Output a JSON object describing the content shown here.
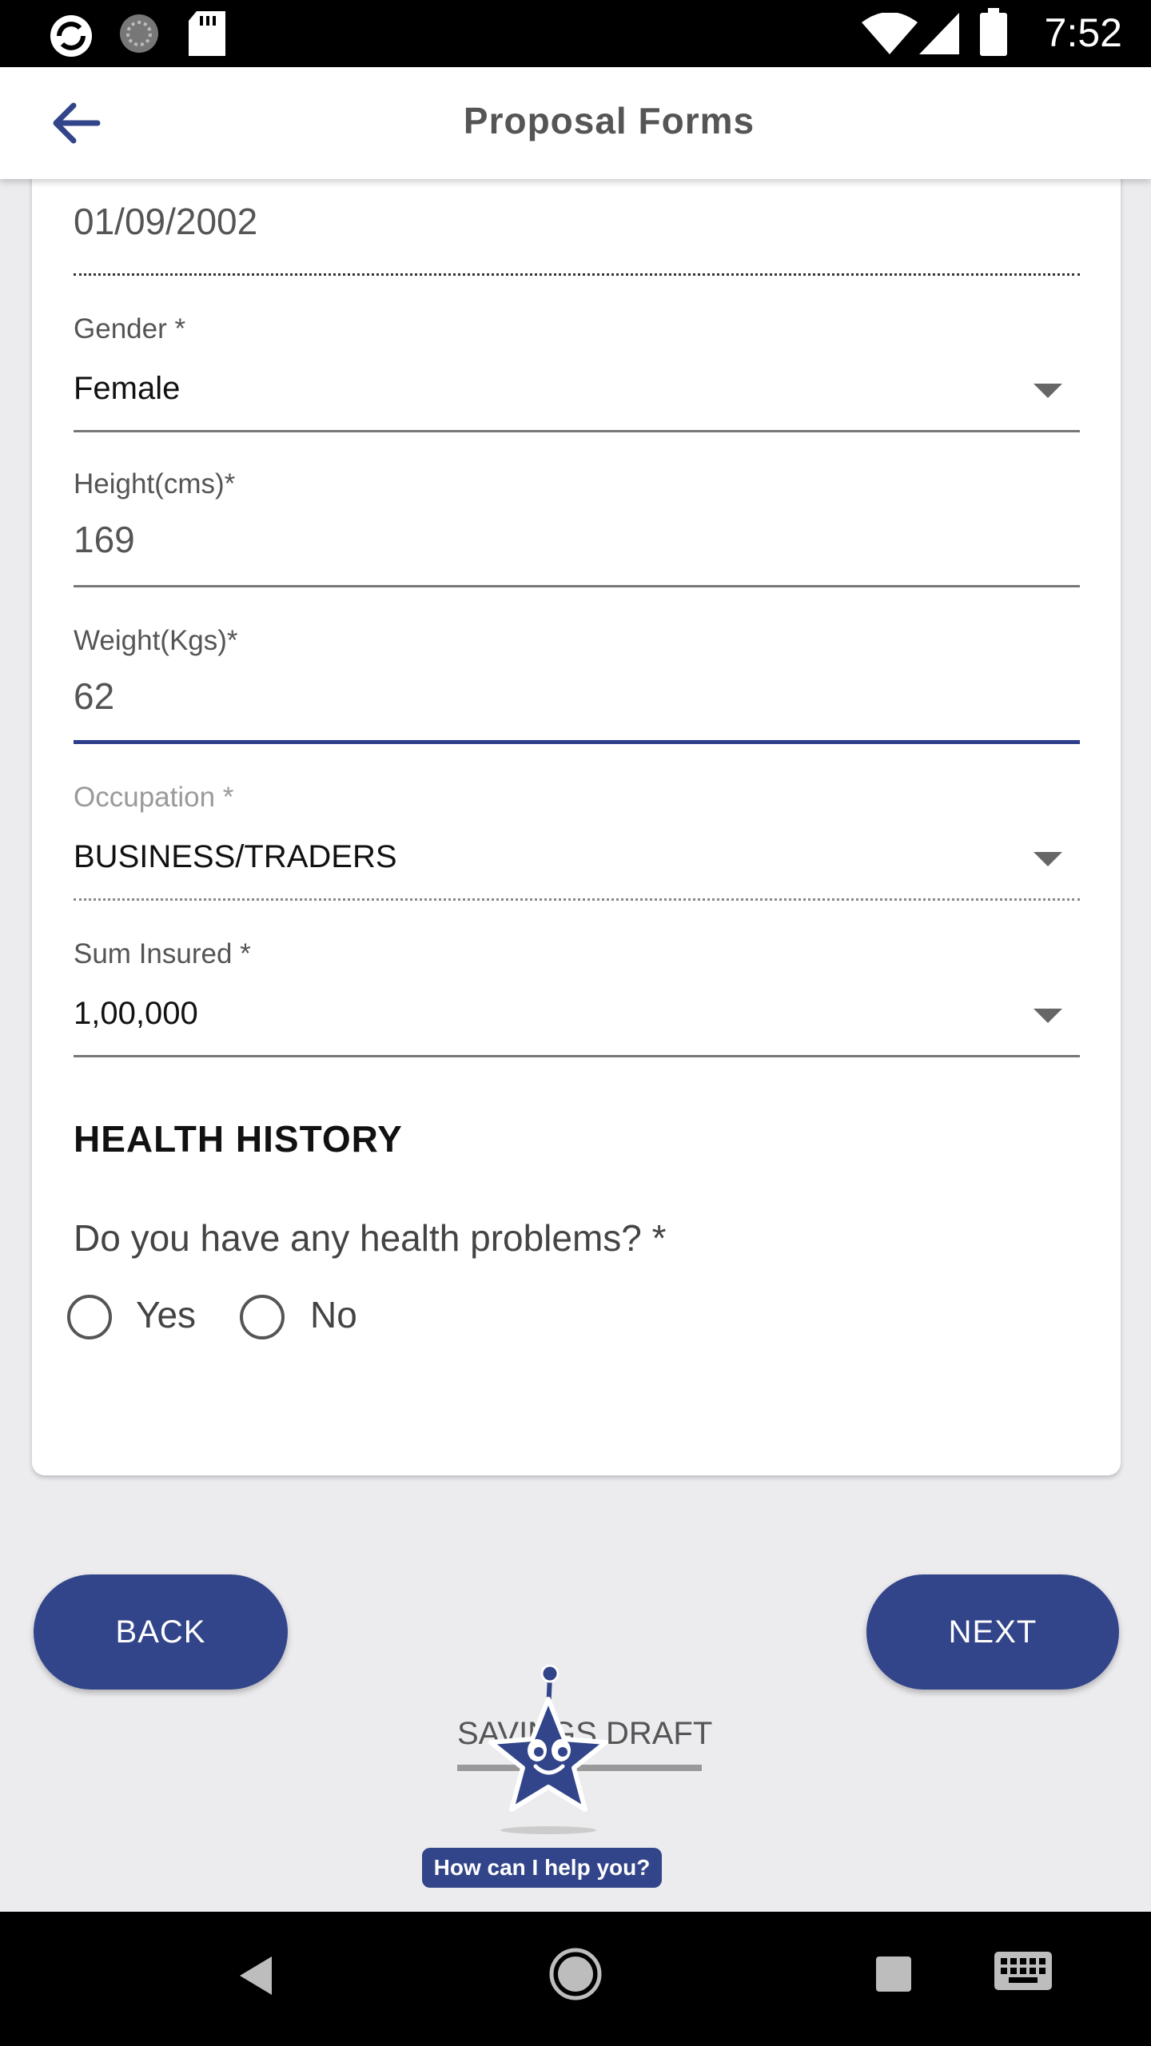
{
  "status_bar": {
    "time": "7:52",
    "icons": [
      "sync-icon",
      "loading-icon",
      "sd-card-icon",
      "wifi-icon",
      "signal-icon",
      "battery-icon"
    ]
  },
  "app_bar": {
    "title": "Proposal Forms",
    "back_icon": "arrow-left-icon"
  },
  "form": {
    "dob": {
      "value": "01/09/2002"
    },
    "gender": {
      "label": "Gender *",
      "value": "Female"
    },
    "height": {
      "label": "Height(cms)*",
      "value": "169"
    },
    "weight": {
      "label": "Weight(Kgs)*",
      "value": "62"
    },
    "occupation": {
      "label": "Occupation *",
      "value": "BUSINESS/TRADERS"
    },
    "sum_insured": {
      "label": "Sum Insured *",
      "value": "1,00,000"
    }
  },
  "health_history": {
    "title": "HEALTH HISTORY",
    "question": "Do you have any health problems?  *",
    "options": [
      "Yes",
      "No"
    ]
  },
  "buttons": {
    "back": "BACK",
    "next": "NEXT"
  },
  "chat_widget": {
    "brand_text": "SAVINGS DRAFT",
    "help_text": "How can I help you?"
  },
  "colors": {
    "primary": "#33458a",
    "background": "#ececef"
  }
}
